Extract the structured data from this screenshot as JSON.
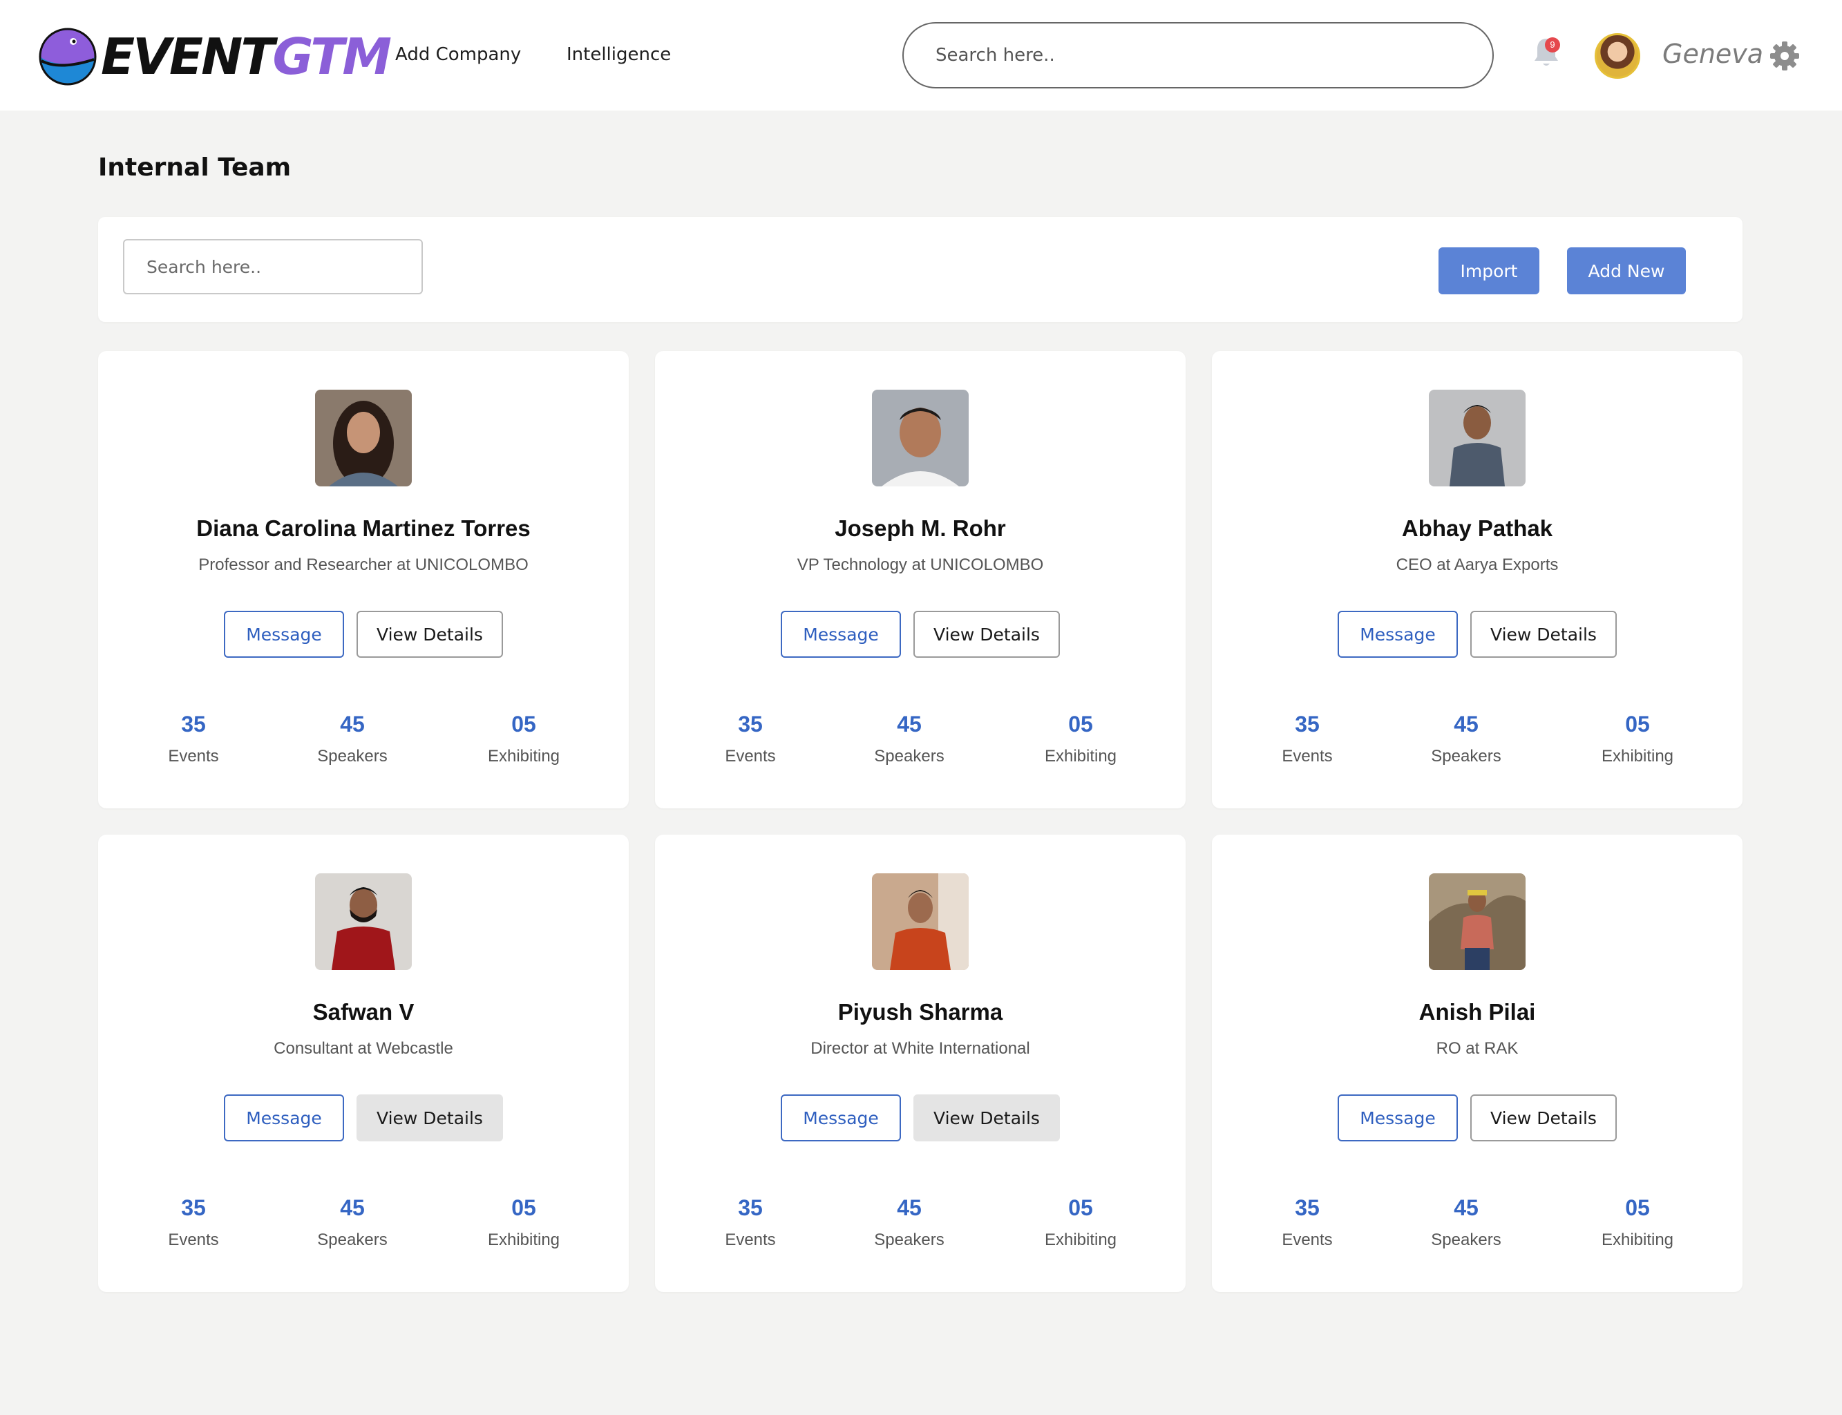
{
  "brand": {
    "logo_part1": "EVENT",
    "logo_part2": "GTM",
    "accent": "#8b5fd8"
  },
  "nav": {
    "add_company": "Add Company",
    "intelligence": "Intelligence"
  },
  "header": {
    "search_placeholder": "Search here..",
    "notification_count": "9",
    "user_name": "Geneva"
  },
  "page": {
    "title": "Internal Team"
  },
  "toolbar": {
    "search_placeholder": "Search here..",
    "import_label": "Import",
    "add_new_label": "Add New"
  },
  "labels": {
    "message": "Message",
    "view_details": "View Details",
    "events": "Events",
    "speakers": "Speakers",
    "exhibiting": "Exhibiting"
  },
  "colors": {
    "primary": "#5b83d6",
    "link_blue": "#3566c4",
    "background": "#f3f3f2"
  },
  "members": [
    {
      "name": "Diana Carolina Martinez Torres",
      "role": "Professor and Researcher at UNICOLOMBO",
      "events": "35",
      "speakers": "45",
      "exhibiting": "05"
    },
    {
      "name": "Joseph M. Rohr",
      "role": "VP Technology at UNICOLOMBO",
      "events": "35",
      "speakers": "45",
      "exhibiting": "05"
    },
    {
      "name": "Abhay Pathak",
      "role": "CEO at Aarya Exports",
      "events": "35",
      "speakers": "45",
      "exhibiting": "05"
    },
    {
      "name": "Safwan V",
      "role": "Consultant at Webcastle",
      "events": "35",
      "speakers": "45",
      "exhibiting": "05"
    },
    {
      "name": "Piyush Sharma",
      "role": "Director at White International",
      "events": "35",
      "speakers": "45",
      "exhibiting": "05"
    },
    {
      "name": "Anish Pilai",
      "role": "RO at RAK",
      "events": "35",
      "speakers": "45",
      "exhibiting": "05"
    }
  ]
}
